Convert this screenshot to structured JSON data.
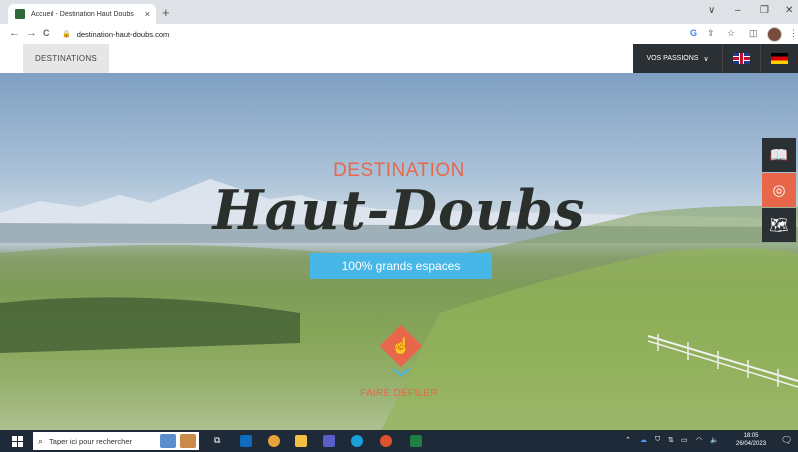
{
  "browser": {
    "tab_title": "Accueil - Destination Haut Doubs",
    "tab_close": "×",
    "new_tab": "+",
    "url": "destination-haut-doubs.com",
    "back": "←",
    "forward": "→",
    "reload": "C",
    "window_controls": {
      "menu": "∨",
      "minimize": "–",
      "restore": "❐",
      "close": "✕"
    }
  },
  "site_nav": {
    "destinations": "DESTINATIONS",
    "passions": "VOS PASSIONS",
    "passions_chevron": "∨",
    "languages": [
      "English",
      "Deutsch"
    ]
  },
  "hero": {
    "kicker": "DESTINATION",
    "title": "Haut-Doubs",
    "badge": "100% grands espaces",
    "scroll_label": "FAIRE DÉFILER"
  },
  "side_buttons": [
    {
      "icon": "brochure-icon",
      "color": "#2b3035"
    },
    {
      "icon": "webcam-icon",
      "color": "#e8674a"
    },
    {
      "icon": "map-icon",
      "color": "#2b3035"
    }
  ],
  "taskbar": {
    "search_placeholder": "Taper ici pour rechercher",
    "time": "18:05",
    "date": "26/04/2023"
  },
  "colors": {
    "accent": "#e8674a",
    "badge": "#46b7e6",
    "dark": "#2b3035"
  }
}
